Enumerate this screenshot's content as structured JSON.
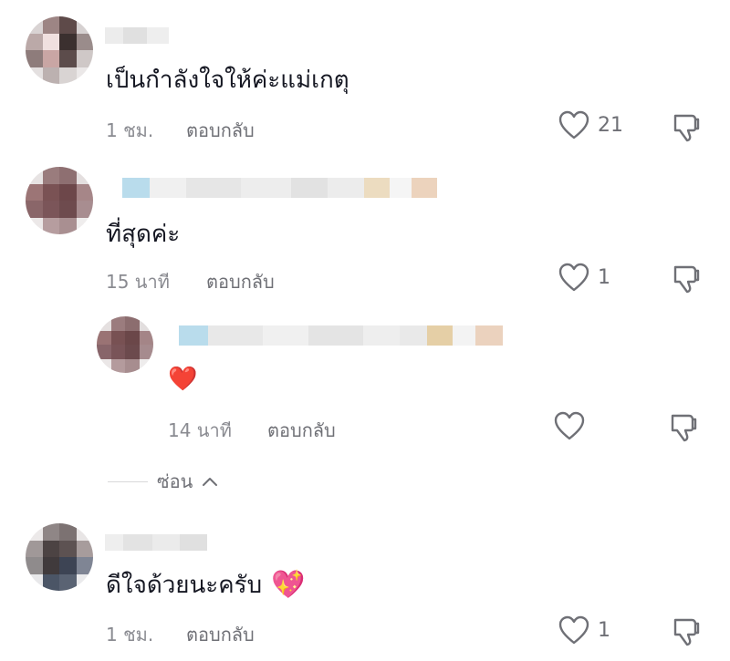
{
  "comments": [
    {
      "text": "เป็นกำลังใจให้ค่ะแม่เกตุ",
      "time": "1 ชม.",
      "reply_label": "ตอบกลับ",
      "likes": "21"
    },
    {
      "text": "ที่สุดค่ะ",
      "time": "15 นาที",
      "reply_label": "ตอบกลับ",
      "likes": "1",
      "replies": [
        {
          "text": "❤️",
          "time": "14 นาที",
          "reply_label": "ตอบกลับ",
          "likes": ""
        }
      ],
      "hide_label": "ซ่อน"
    },
    {
      "text": "ดีใจด้วยนะครับ",
      "emoji": "💖",
      "time": "1 ชม.",
      "reply_label": "ตอบกลับ",
      "likes": "1"
    }
  ],
  "icons": {
    "like": "heart-outline-icon",
    "dislike": "thumbs-down-outline-icon",
    "hide": "chevron-up-icon"
  },
  "colors": {
    "text": "#161823",
    "secondary": "#8a8b91",
    "icon": "#6f7076"
  }
}
